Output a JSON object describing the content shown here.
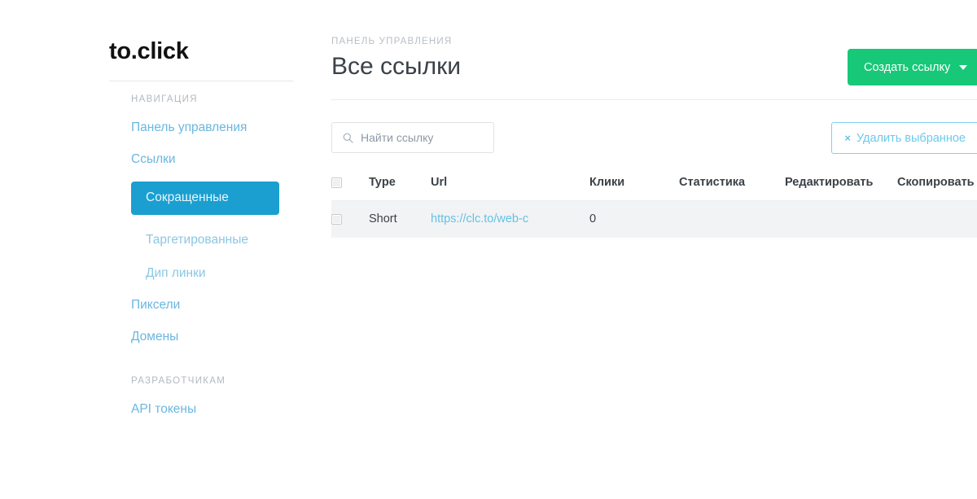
{
  "sidebar": {
    "logo": "to.click",
    "nav_section_label": "НАВИГАЦИЯ",
    "items": [
      {
        "label": "Панель управления",
        "level": "top",
        "active": false
      },
      {
        "label": "Ссылки",
        "level": "top",
        "active": false
      },
      {
        "label": "Сокращенные",
        "level": "sub",
        "active": true
      },
      {
        "label": "Таргетированные",
        "level": "sub",
        "active": false
      },
      {
        "label": "Дип линки",
        "level": "sub",
        "active": false
      },
      {
        "label": "Пиксели",
        "level": "top",
        "active": false
      },
      {
        "label": "Домены",
        "level": "top",
        "active": false
      }
    ],
    "devs_section_label": "РАЗРАБОТЧИКАМ",
    "devs_items": [
      {
        "label": "API токены"
      }
    ]
  },
  "header": {
    "breadcrumb": "ПАНЕЛЬ УПРАВЛЕНИЯ",
    "title": "Все ссылки",
    "create_button": "Создать ссылку"
  },
  "toolbar": {
    "search_placeholder": "Найти ссылку",
    "search_value": "",
    "search_icon": "search-icon",
    "delete_button": "Удалить выбранное",
    "delete_icon": "×"
  },
  "table": {
    "columns": [
      {
        "key": "check",
        "label": ""
      },
      {
        "key": "type",
        "label": "Type"
      },
      {
        "key": "url",
        "label": "Url"
      },
      {
        "key": "clicks",
        "label": "Клики"
      },
      {
        "key": "stats",
        "label": "Статистика"
      },
      {
        "key": "edit",
        "label": "Редактировать"
      },
      {
        "key": "copy",
        "label": "Скопировать"
      }
    ],
    "rows": [
      {
        "type": "Short",
        "url": "https://clc.to/web-c",
        "clicks": "0",
        "stats": "",
        "edit": "",
        "copy": ""
      }
    ]
  },
  "colors": {
    "accent_blue": "#1b9fd0",
    "link_blue": "#6ab7e0",
    "green": "#17c878",
    "text_dark": "#3b4148",
    "muted": "#b3b9bf",
    "row_bg": "#f2f3f4"
  }
}
